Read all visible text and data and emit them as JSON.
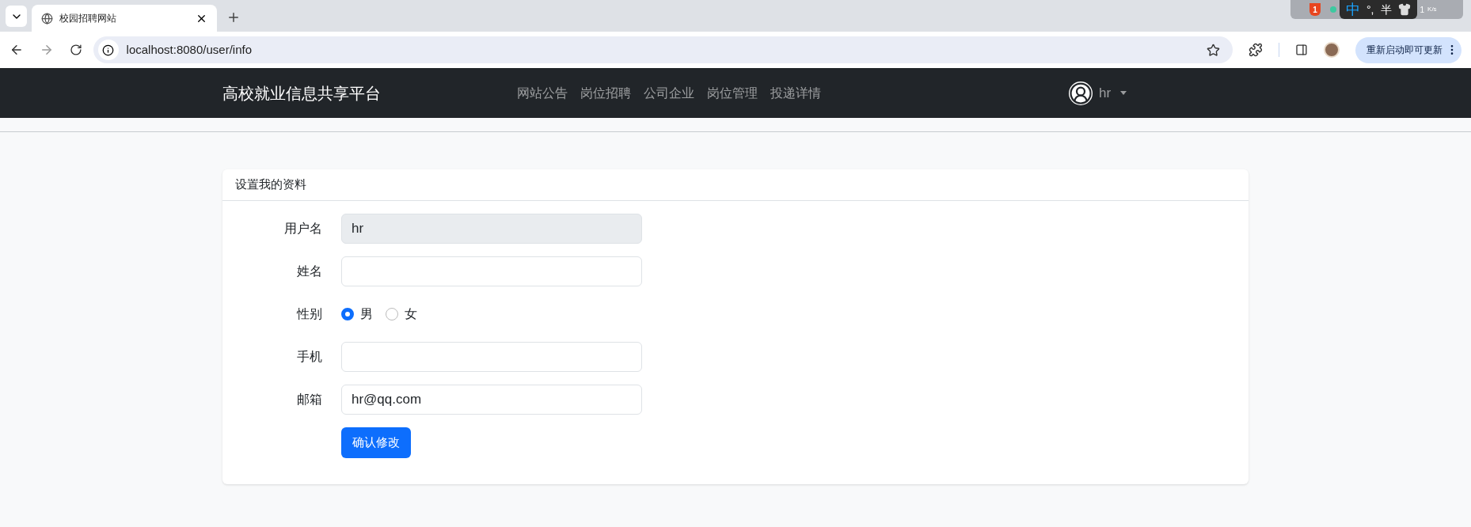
{
  "browser": {
    "tabs": [
      {
        "title": "校园招聘网站",
        "selected": true
      }
    ],
    "url": "localhost:8080/user/info",
    "update_button": "重新启动即可更新"
  },
  "ime_bar": {
    "badge": "1",
    "mode": "中",
    "punctuation": "°,",
    "width": "半",
    "speed": "1",
    "speed_unit": "K/s"
  },
  "navbar": {
    "brand": "高校就业信息共享平台",
    "links": [
      "网站公告",
      "岗位招聘",
      "公司企业",
      "岗位管理",
      "投递详情"
    ],
    "user": "hr"
  },
  "card": {
    "title": "设置我的资料",
    "fields": [
      {
        "kind": "text",
        "label": "用户名",
        "value": "hr",
        "disabled": true
      },
      {
        "kind": "text",
        "label": "姓名",
        "disabled": false
      },
      {
        "kind": "radio",
        "label": "性别",
        "options": [
          {
            "label": "男",
            "selected": true
          },
          {
            "label": "女",
            "selected": false
          }
        ]
      },
      {
        "kind": "text",
        "label": "手机",
        "disabled": false
      },
      {
        "kind": "text",
        "label": "邮箱",
        "value": "hr@qq.com",
        "disabled": false
      }
    ],
    "submit": "确认修改"
  }
}
